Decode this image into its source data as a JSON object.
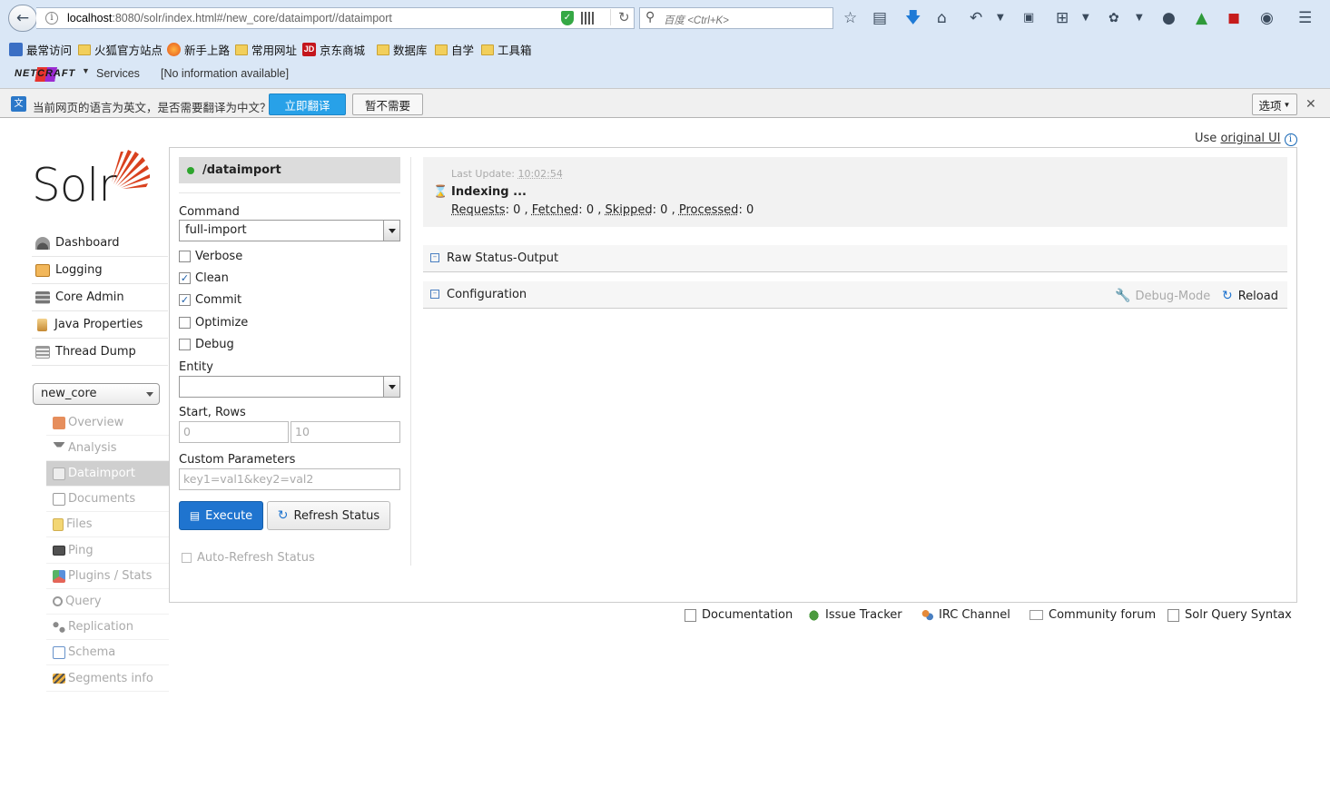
{
  "browser": {
    "url_host": "localhost",
    "url_rest": ":8080/solr/index.html#/new_core/dataimport//dataimport",
    "search_placeholder": "百度 <Ctrl+K>",
    "bookmarks": [
      "最常访问",
      "火狐官方站点",
      "新手上路",
      "常用网址",
      "京东商城",
      "数据库",
      "自学",
      "工具箱"
    ],
    "netcraft": {
      "logo": "NETCRAFT",
      "services": "Services",
      "info": "[No information available]"
    },
    "translate": {
      "message": "当前网页的语言为英文，是否需要翻译为中文？",
      "translate_btn": "立即翻译",
      "no_btn": "暂不需要",
      "options_btn": "选项"
    }
  },
  "header": {
    "use_prefix": "Use",
    "original_ui": "original UI"
  },
  "logo": "Solr",
  "nav": [
    {
      "label": "Dashboard"
    },
    {
      "label": "Logging"
    },
    {
      "label": "Core Admin"
    },
    {
      "label": "Java Properties"
    },
    {
      "label": "Thread Dump"
    }
  ],
  "core_selector": "new_core",
  "core_menu": [
    {
      "label": "Overview"
    },
    {
      "label": "Analysis"
    },
    {
      "label": "Dataimport"
    },
    {
      "label": "Documents"
    },
    {
      "label": "Files"
    },
    {
      "label": "Ping"
    },
    {
      "label": "Plugins / Stats"
    },
    {
      "label": "Query"
    },
    {
      "label": "Replication"
    },
    {
      "label": "Schema"
    },
    {
      "label": "Segments info"
    }
  ],
  "dataimport": {
    "handler": "/dataimport",
    "command_label": "Command",
    "command_value": "full-import",
    "options": [
      {
        "label": "Verbose",
        "checked": false
      },
      {
        "label": "Clean",
        "checked": true
      },
      {
        "label": "Commit",
        "checked": true
      },
      {
        "label": "Optimize",
        "checked": false
      },
      {
        "label": "Debug",
        "checked": false
      }
    ],
    "entity_label": "Entity",
    "entity_value": "",
    "start_rows_label": "Start, Rows",
    "start_placeholder": "0",
    "rows_placeholder": "10",
    "custom_label": "Custom Parameters",
    "custom_placeholder": "key1=val1&key2=val2",
    "execute": "Execute",
    "refresh": "Refresh Status",
    "auto_refresh": "Auto-Refresh Status"
  },
  "status": {
    "last_update_label": "Last Update:",
    "last_update_time": "10:02:54",
    "state": "Indexing ...",
    "requests_label": "Requests",
    "requests": "0",
    "fetched_label": "Fetched",
    "fetched": "0",
    "skipped_label": "Skipped",
    "skipped": "0",
    "processed_label": "Processed",
    "processed": "0"
  },
  "sections": {
    "raw": "Raw Status-Output",
    "config": "Configuration",
    "debug_mode": "Debug-Mode",
    "reload": "Reload"
  },
  "footer": [
    "Documentation",
    "Issue Tracker",
    "IRC Channel",
    "Community forum",
    "Solr Query Syntax"
  ]
}
